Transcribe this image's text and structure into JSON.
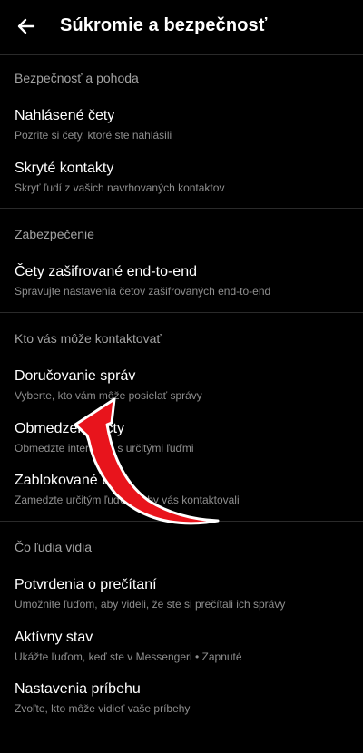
{
  "header": {
    "title": "Súkromie a bezpečnosť",
    "back_icon": "arrow-left-icon"
  },
  "sections": [
    {
      "header": "Bezpečnosť a pohoda",
      "items": [
        {
          "title": "Nahlásené čety",
          "subtitle": "Pozrite si čety, ktoré ste nahlásili"
        },
        {
          "title": "Skryté kontakty",
          "subtitle": "Skryť ľudí z vašich navrhovaných kontaktov"
        }
      ]
    },
    {
      "header": "Zabezpečenie",
      "items": [
        {
          "title": "Čety zašifrované end-to-end",
          "subtitle": "Spravujte nastavenia četov zašifrovaných end-to-end"
        }
      ]
    },
    {
      "header": "Kto vás môže kontaktovať",
      "items": [
        {
          "title": "Doručovanie správ",
          "subtitle": "Vyberte, kto vám môže posielať správy"
        },
        {
          "title": "Obmedzené účty",
          "subtitle": "Obmedzte interakcie s určitými ľuďmi"
        },
        {
          "title": "Zablokované účty",
          "subtitle": "Zamedzte určitým ľuďom, aby vás kontaktovali"
        }
      ]
    },
    {
      "header": "Čo ľudia vidia",
      "items": [
        {
          "title": "Potvrdenia o prečítaní",
          "subtitle": "Umožnite ľuďom, aby videli, že ste si prečítali ich správy"
        },
        {
          "title": "Aktívny stav",
          "subtitle": "Ukážte ľuďom, keď ste v Messengeri • Zapnuté"
        },
        {
          "title": "Nastavenia príbehu",
          "subtitle": "Zvoľte, kto môže vidieť vaše príbehy"
        }
      ]
    }
  ],
  "annotation": {
    "icon": "curved-arrow-icon",
    "color": "#e8141c"
  },
  "colors": {
    "background": "#000000",
    "text_primary": "#ffffff",
    "text_secondary": "#8e8e8e",
    "section_header": "#a3a3a3",
    "divider": "#2a2a2a"
  }
}
